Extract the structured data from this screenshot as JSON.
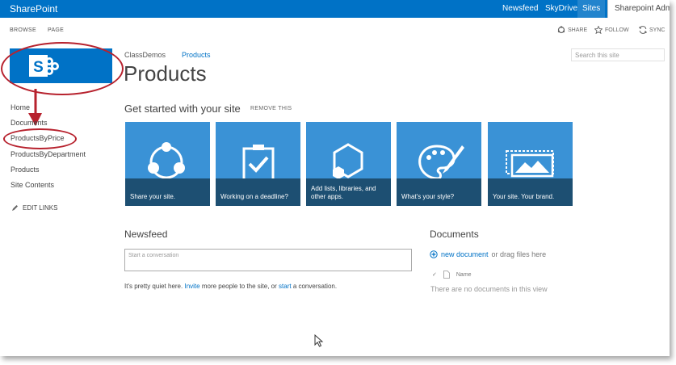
{
  "topbar": {
    "brand": "SharePoint",
    "nav": [
      "Newsfeed",
      "SkyDrive",
      "Sites"
    ],
    "user": "Sharepoint Adm",
    "accent": "#0072c6"
  },
  "ribbon": {
    "tabs": [
      "BROWSE",
      "PAGE"
    ],
    "actions": [
      "SHARE",
      "FOLLOW",
      "SYNC"
    ]
  },
  "left_nav": {
    "items": [
      "Home",
      "Documents",
      "ProductsByPrice",
      "ProductsByDepartment",
      "Products",
      "Site Contents"
    ],
    "edit_links": "EDIT LINKS"
  },
  "breadcrumb": [
    "ClassDemos",
    "Products"
  ],
  "page_title": "Products",
  "search": {
    "placeholder": "Search this site"
  },
  "get_started": {
    "heading": "Get started with your site",
    "remove": "REMOVE THIS",
    "tiles": [
      {
        "label": "Share your site.",
        "icon": "share-icon"
      },
      {
        "label": "Working on a deadline?",
        "icon": "clipboard-check-icon"
      },
      {
        "label": "Add lists, libraries, and other apps.",
        "icon": "hexagon-apps-icon"
      },
      {
        "label": "What's your style?",
        "icon": "palette-icon"
      },
      {
        "label": "Your site. Your brand.",
        "icon": "image-brand-icon"
      }
    ]
  },
  "newsfeed": {
    "title": "Newsfeed",
    "placeholder": "Start a conversation",
    "quiet_prefix": "It's pretty quiet here.",
    "invite": "Invite",
    "quiet_middle": "more people to the site, or",
    "start": "start",
    "quiet_suffix": "a conversation."
  },
  "documents": {
    "title": "Documents",
    "new_document": "new document",
    "drag": "or drag files here",
    "name_col": "Name",
    "empty": "There are no documents in this view"
  }
}
